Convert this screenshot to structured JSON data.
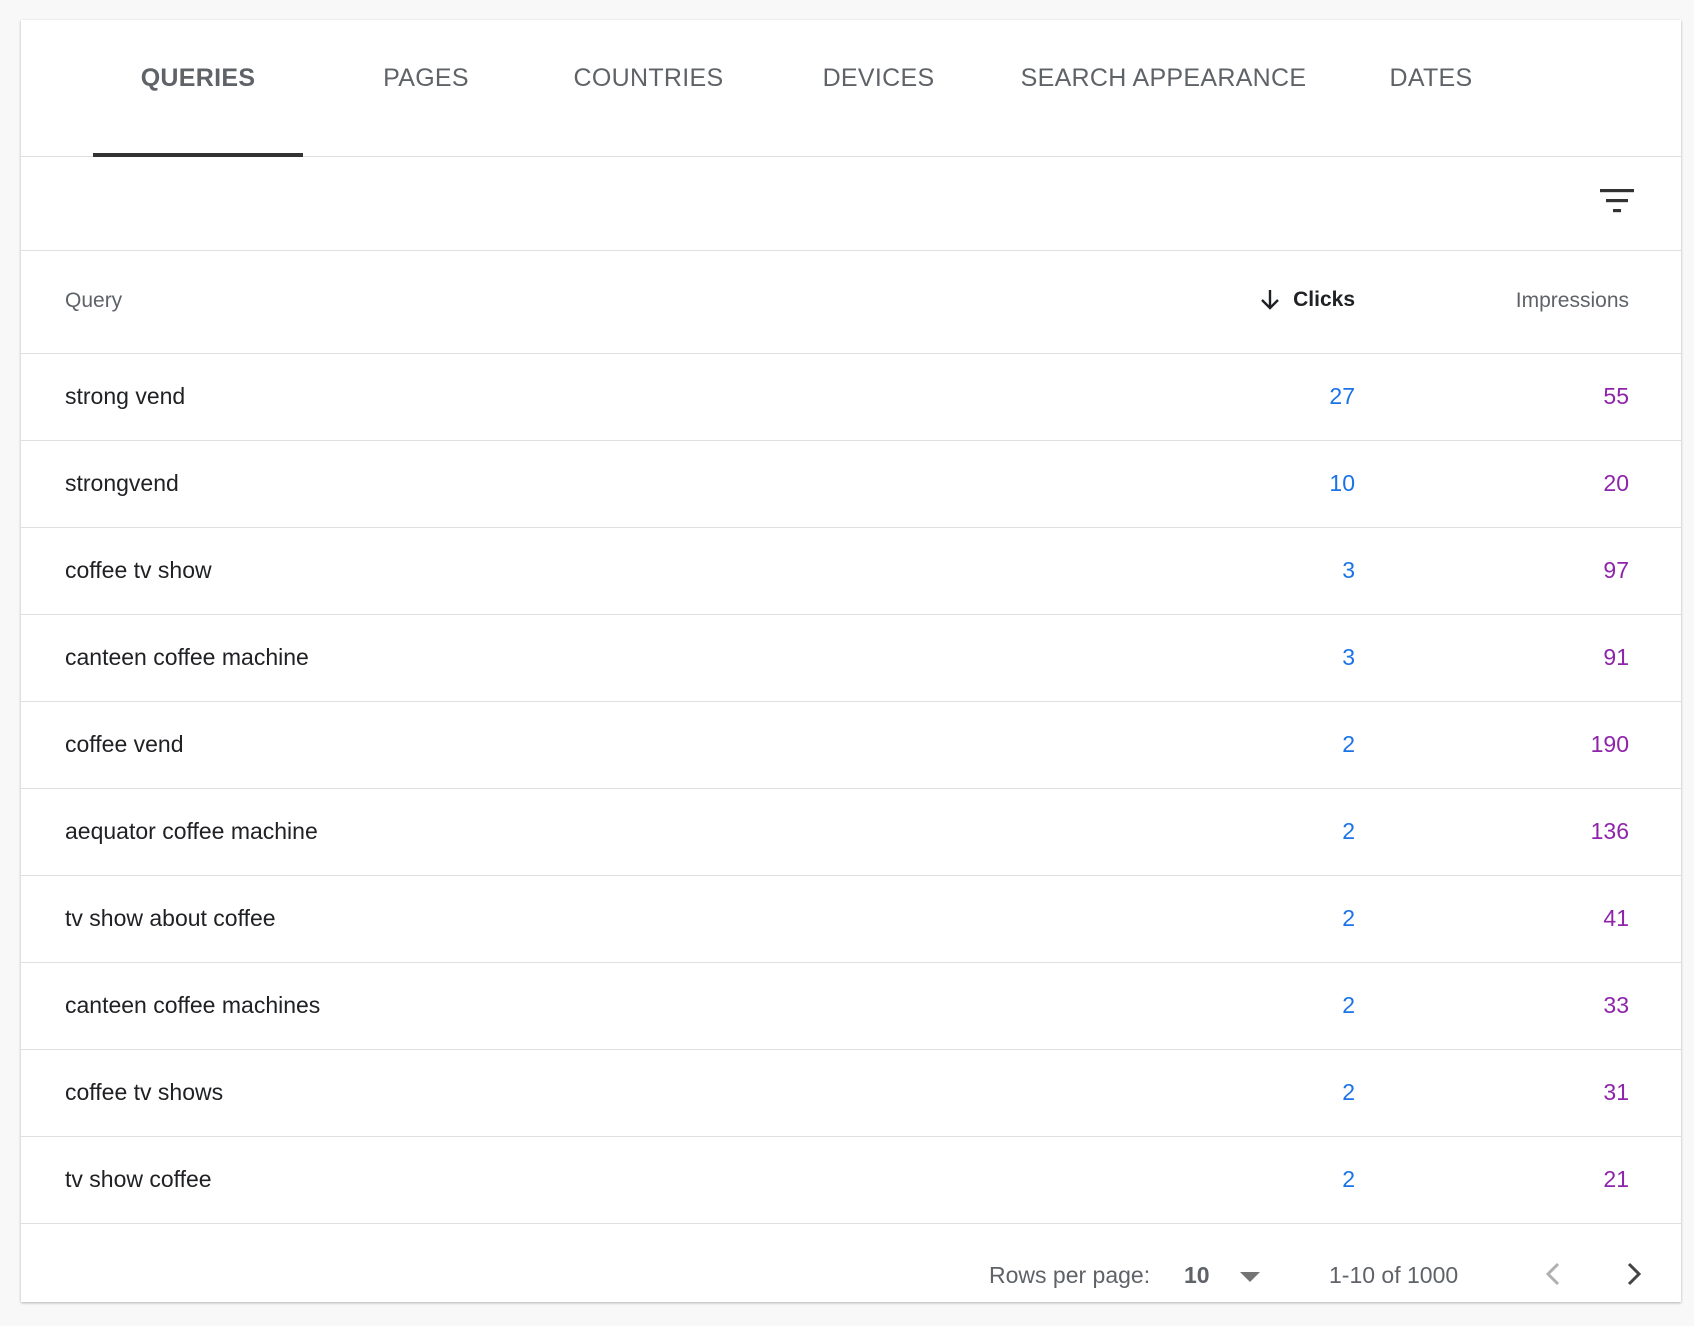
{
  "tabs": [
    {
      "label": "QUERIES",
      "active": true
    },
    {
      "label": "PAGES",
      "active": false
    },
    {
      "label": "COUNTRIES",
      "active": false
    },
    {
      "label": "DEVICES",
      "active": false
    },
    {
      "label": "SEARCH APPEARANCE",
      "active": false
    },
    {
      "label": "DATES",
      "active": false
    }
  ],
  "toolbar": {
    "filter_icon": "filter-icon"
  },
  "table": {
    "columns": {
      "query": "Query",
      "clicks": "Clicks",
      "impressions": "Impressions"
    },
    "sort": {
      "column": "Clicks",
      "direction": "descending",
      "icon": "arrow-down-icon"
    },
    "rows": [
      {
        "query": "strong vend",
        "clicks": "27",
        "impressions": "55"
      },
      {
        "query": "strongvend",
        "clicks": "10",
        "impressions": "20"
      },
      {
        "query": "coffee tv show",
        "clicks": "3",
        "impressions": "97"
      },
      {
        "query": "canteen coffee machine",
        "clicks": "3",
        "impressions": "91"
      },
      {
        "query": "coffee vend",
        "clicks": "2",
        "impressions": "190"
      },
      {
        "query": "aequator coffee machine",
        "clicks": "2",
        "impressions": "136"
      },
      {
        "query": "tv show about coffee",
        "clicks": "2",
        "impressions": "41"
      },
      {
        "query": "canteen coffee machines",
        "clicks": "2",
        "impressions": "33"
      },
      {
        "query": "coffee tv shows",
        "clicks": "2",
        "impressions": "31"
      },
      {
        "query": "tv show coffee",
        "clicks": "2",
        "impressions": "21"
      }
    ]
  },
  "footer": {
    "rows_per_page_label": "Rows per page:",
    "rows_per_page_value": "10",
    "range": "1-10 of 1000"
  },
  "colors": {
    "clicks": "#1a73e8",
    "impressions": "#8e24aa",
    "active_tab_ink": "#333333"
  }
}
